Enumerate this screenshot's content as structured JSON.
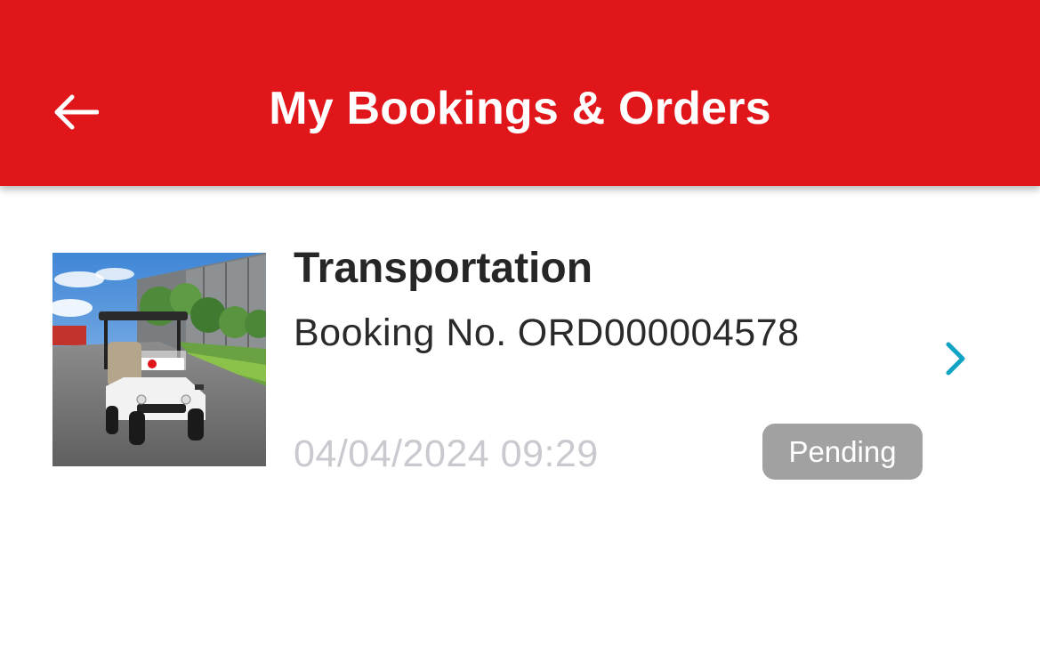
{
  "header": {
    "title": "My Bookings & Orders",
    "back_icon": "arrow-left-icon",
    "background_color": "#e0161b"
  },
  "bookings": [
    {
      "service": "Transportation",
      "booking_label": "Booking No.",
      "booking_number": "ORD000004578",
      "datetime": "04/04/2024 09:29",
      "status": "Pending",
      "status_color": "#a1a1a1",
      "chevron_icon": "chevron-right-icon",
      "chevron_color": "#10a3c4",
      "image": "golf-cart-photo"
    }
  ]
}
